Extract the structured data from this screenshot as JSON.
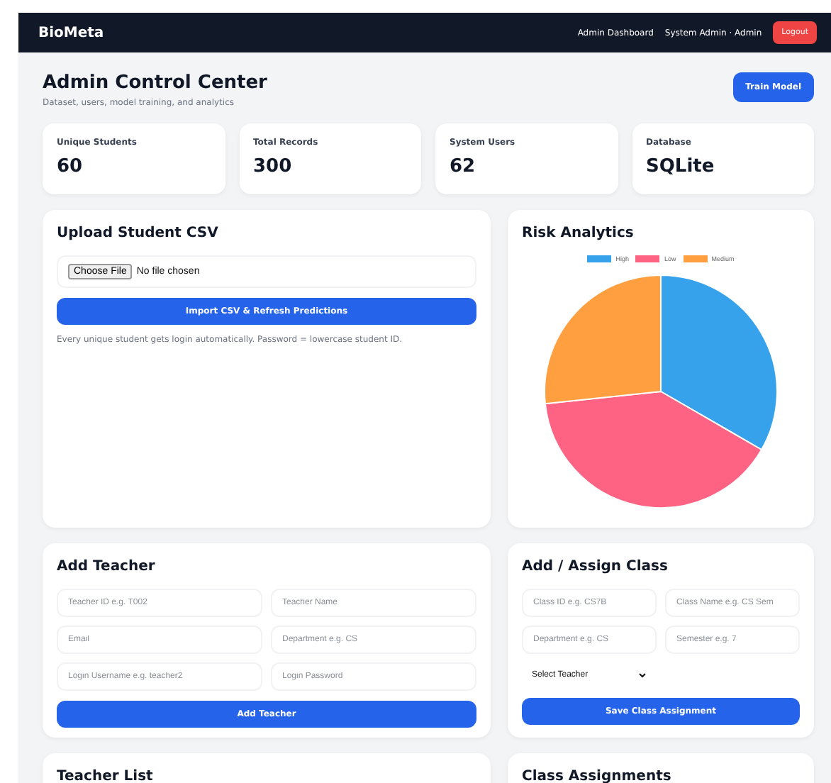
{
  "navbar": {
    "brand": "BioMeta",
    "links": [
      "Admin Dashboard",
      "System Admin · Admin"
    ],
    "logout": "Logout"
  },
  "header": {
    "title": "Admin Control Center",
    "subtitle": "Dataset, users, model training, and analytics",
    "action": "Train Model"
  },
  "stats": [
    {
      "label": "Unique Students",
      "value": "60"
    },
    {
      "label": "Total Records",
      "value": "300"
    },
    {
      "label": "System Users",
      "value": "62"
    },
    {
      "label": "Database",
      "value": "SQLite"
    }
  ],
  "upload": {
    "title": "Upload Student CSV",
    "file_button": "Choose File",
    "file_status": "No file chosen",
    "submit": "Import CSV & Refresh Predictions",
    "note": "Every unique student gets login automatically. Password = lowercase student ID."
  },
  "risk": {
    "title": "Risk Analytics",
    "legend": [
      {
        "label": "High",
        "color": "#36a2eb"
      },
      {
        "label": "Low",
        "color": "#ff6384"
      },
      {
        "label": "Medium",
        "color": "#ff9f40"
      }
    ]
  },
  "add_teacher": {
    "title": "Add Teacher",
    "fields": [
      {
        "placeholder": "Teacher ID e.g. T002"
      },
      {
        "placeholder": "Teacher Name"
      },
      {
        "placeholder": "Email"
      },
      {
        "placeholder": "Department e.g. CS"
      },
      {
        "placeholder": "Login Username e.g. teacher2"
      },
      {
        "placeholder": "Login Password"
      }
    ],
    "submit": "Add Teacher"
  },
  "assign_class": {
    "title": "Add / Assign Class",
    "fields": [
      {
        "placeholder": "Class ID e.g. CS7B"
      },
      {
        "placeholder": "Class Name e.g. CS Sem"
      },
      {
        "placeholder": "Department e.g. CS"
      },
      {
        "placeholder": "Semester e.g. 7"
      }
    ],
    "select": "Select Teacher",
    "submit": "Save Class Assignment"
  },
  "lower_cards": [
    {
      "title": "Teacher List"
    },
    {
      "title": "Class Assignments"
    }
  ]
}
